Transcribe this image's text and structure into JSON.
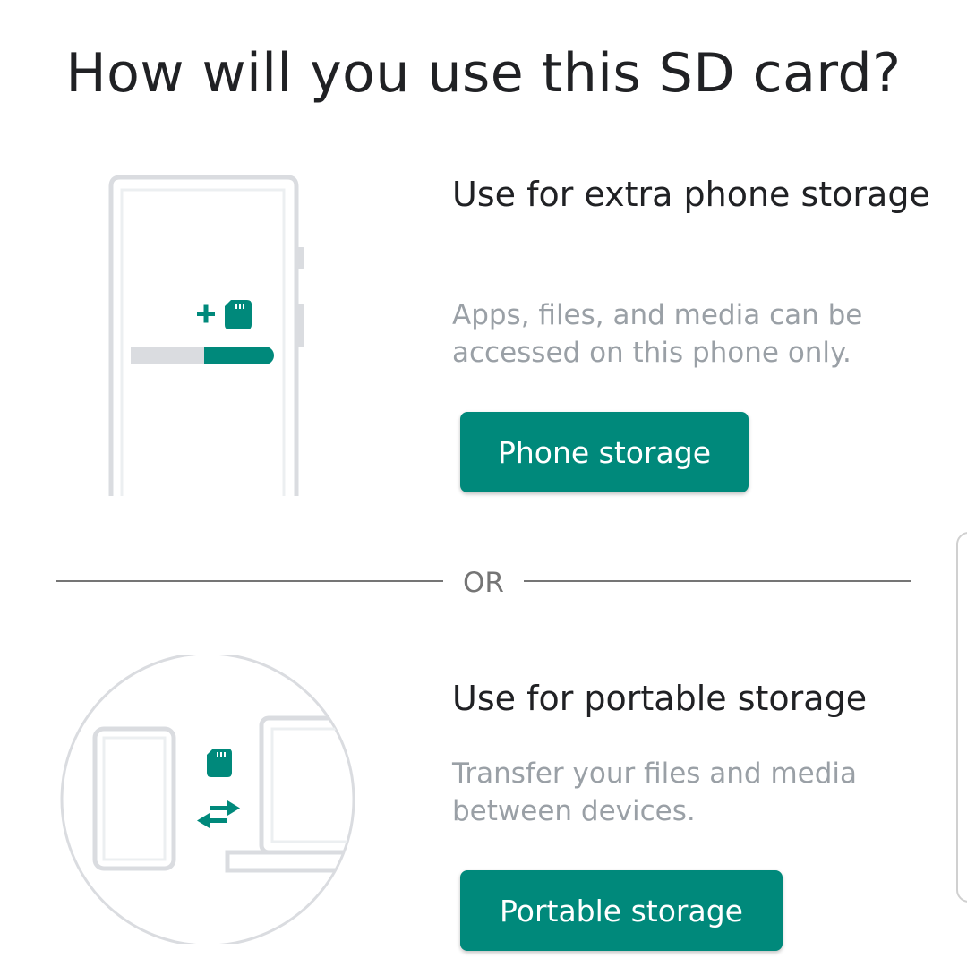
{
  "title": "How will you use this SD card?",
  "option_internal": {
    "title": "Use for extra phone storage",
    "description": "Apps, files, and media can be accessed on this phone only.",
    "button_label": "Phone storage",
    "icon": "phone-with-sd-card-illustration"
  },
  "separator_label": "OR",
  "option_portable": {
    "title": "Use for portable storage",
    "description": "Transfer your files and media between devices.",
    "button_label": "Portable storage",
    "icon": "transfer-between-devices-illustration"
  },
  "colors": {
    "accent": "#00897b",
    "title_text": "#202124",
    "secondary_text": "#9aa0a6",
    "divider": "#757575",
    "illustration_outline": "#dadce0"
  }
}
